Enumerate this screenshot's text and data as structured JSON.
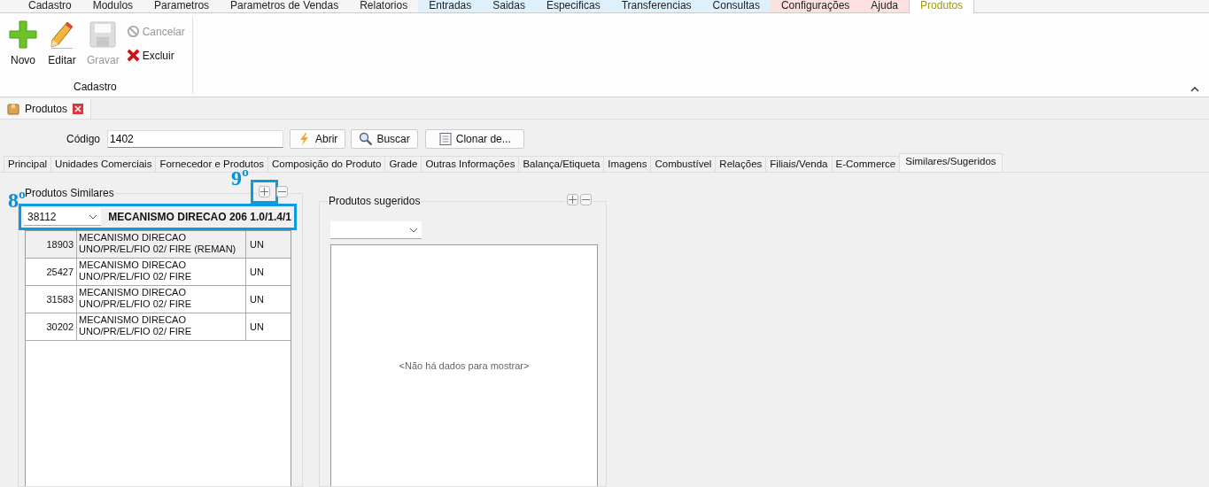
{
  "menu_tabs": [
    {
      "label": "Cadastro",
      "color": "#f5f5f5",
      "selected": false
    },
    {
      "label": "Modulos",
      "color": "#f5f5f5",
      "selected": false
    },
    {
      "label": "Parametros",
      "color": "#f5f5f5",
      "selected": false
    },
    {
      "label": "Parametros de Vendas",
      "color": "#f5f5f5",
      "selected": false
    },
    {
      "label": "Relatorios",
      "color": "#f5f5f5",
      "selected": false
    },
    {
      "label": "Entradas",
      "color": "#dff0fd",
      "selected": false
    },
    {
      "label": "Saidas",
      "color": "#dff0fd",
      "selected": false
    },
    {
      "label": "Especificas",
      "color": "#dff0fd",
      "selected": false
    },
    {
      "label": "Transferencias",
      "color": "#dff0fd",
      "selected": false
    },
    {
      "label": "Consultas",
      "color": "#dff0fd",
      "selected": false
    },
    {
      "label": "Configurações",
      "color": "#fde0e0",
      "selected": false
    },
    {
      "label": "Ajuda",
      "color": "#fde0e0",
      "selected": false
    },
    {
      "label": "Produtos",
      "color": "#ffffff",
      "selected": true
    }
  ],
  "ribbon": {
    "group_label": "Cadastro",
    "buttons": [
      {
        "kind": "large",
        "label": "Novo",
        "disabled": false
      },
      {
        "kind": "large",
        "label": "Editar",
        "disabled": false
      },
      {
        "kind": "large",
        "label": "Gravar",
        "disabled": true
      },
      {
        "kind": "small",
        "label": "Cancelar",
        "disabled": true
      },
      {
        "kind": "small",
        "label": "Excluir",
        "disabled": false
      }
    ]
  },
  "document_tab": {
    "label": "Produtos"
  },
  "codigo": {
    "label": "Código",
    "value": "1402",
    "buttons": [
      {
        "label": "Abrir"
      },
      {
        "label": "Buscar"
      },
      {
        "label": "Clonar de..."
      }
    ]
  },
  "tabs": [
    {
      "label": "Principal",
      "selected": false
    },
    {
      "label": "Unidades Comerciais",
      "selected": false
    },
    {
      "label": "Fornecedor e Produtos",
      "selected": false
    },
    {
      "label": "Composição do Produto",
      "selected": false
    },
    {
      "label": "Grade",
      "selected": false
    },
    {
      "label": "Outras Informações",
      "selected": false
    },
    {
      "label": "Balança/Etiqueta",
      "selected": false
    },
    {
      "label": "Imagens",
      "selected": false
    },
    {
      "label": "Combustível",
      "selected": false
    },
    {
      "label": "Relações",
      "selected": false
    },
    {
      "label": "Filiais/Venda",
      "selected": false
    },
    {
      "label": "E-Commerce",
      "selected": false
    },
    {
      "label": "Similares/Sugeridos",
      "selected": true
    }
  ],
  "similares": {
    "title": "Produtos Similares",
    "add_annotation": "9º",
    "combo_annotation": "8º",
    "combo_value": "38112",
    "product_name": "MECANISMO DIRECAO 206 1.0/1.4/1",
    "rows": [
      {
        "code": "18903",
        "description": "MECANISMO DIRECAO UNO/PR/EL/FIO 02/ FIRE (REMAN)",
        "unit": "UN",
        "selected": true
      },
      {
        "code": "25427",
        "description": "MECANISMO DIRECAO UNO/PR/EL/FIO 02/ FIRE",
        "unit": "UN",
        "selected": false
      },
      {
        "code": "31583",
        "description": "MECANISMO DIRECAO UNO/PR/EL/FIO 02/ FIRE",
        "unit": "UN",
        "selected": false
      },
      {
        "code": "30202",
        "description": "MECANISMO DIRECAO UNO/PR/EL/FIO 02/ FIRE",
        "unit": "UN",
        "selected": false
      }
    ]
  },
  "sugeridos": {
    "title": "Produtos sugeridos",
    "empty_message": "<Não há dados para mostrar>"
  }
}
